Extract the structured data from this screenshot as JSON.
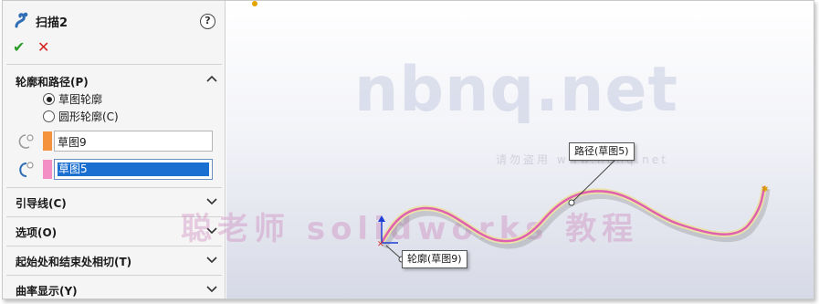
{
  "panel": {
    "title": "扫描2",
    "help": "?",
    "ok": "✔",
    "cancel": "✕",
    "profile_section": {
      "title": "轮廓和路径(P)",
      "options": [
        {
          "label": "草图轮廓",
          "selected": true
        },
        {
          "label": "圆形轮廓(C)",
          "selected": false
        }
      ],
      "profile_value": "草图9",
      "path_value": "草图5"
    },
    "sections": [
      {
        "title": "引导线(C)"
      },
      {
        "title": "选项(O)"
      },
      {
        "title": "起始处和结束处相切(T)"
      },
      {
        "title": "曲率显示(Y)"
      }
    ]
  },
  "colors": {
    "profile_swatch": "#f5923e",
    "path_swatch": "#f48fc5",
    "accent": "#1b6fd1"
  },
  "viewport": {
    "watermark": "nbnq.net",
    "watermark_sub": "请勿盗用 www.nbnq.net",
    "watermark_bottom": "聪老师 solidworks 教程",
    "callout_path": "路径(草图5)",
    "callout_profile": "轮廓(草图9)"
  }
}
